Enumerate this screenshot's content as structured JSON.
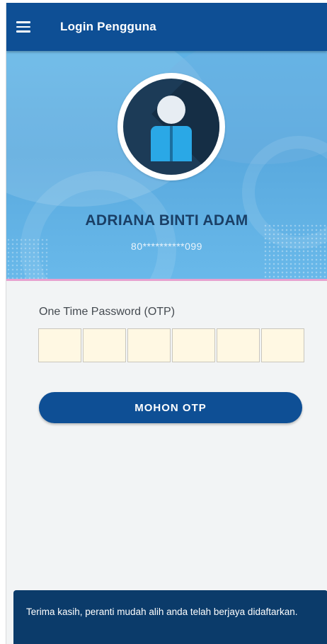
{
  "app_bar": {
    "title": "Login Pengguna",
    "menu_icon": "hamburger-menu-icon"
  },
  "profile": {
    "avatar_icon": "user-avatar-icon",
    "name": "ADRIANA BINTI ADAM",
    "phone_masked": "80**********099"
  },
  "form": {
    "otp_label": "One Time Password (OTP)",
    "otp_digits": [
      "",
      "",
      "",
      "",
      "",
      ""
    ],
    "request_button": "MOHON OTP"
  },
  "snackbar": {
    "message": "Terima kasih, peranti mudah alih anda telah berjaya didaftarkan."
  },
  "colors": {
    "primary": "#0e4f95",
    "banner": "#5eb3e6",
    "otp_box": "#fff8e3",
    "snackbar": "#0b3b6a",
    "accent_line": "#e7a1cf"
  }
}
